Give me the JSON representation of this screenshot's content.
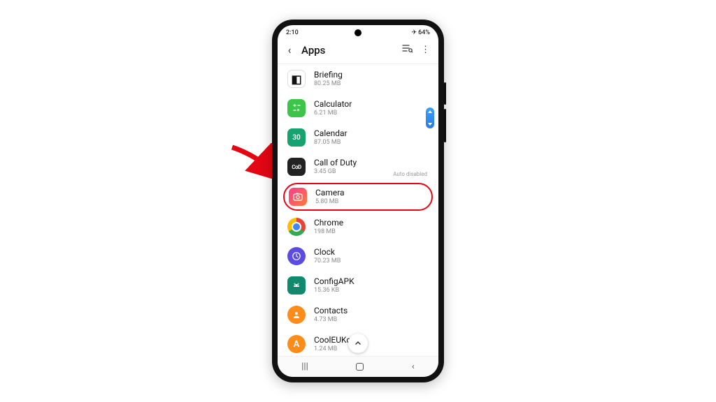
{
  "status": {
    "time": "2:10",
    "battery": "64%"
  },
  "header": {
    "title": "Apps"
  },
  "badge": {
    "auto_disabled": "Auto disabled"
  },
  "apps": [
    {
      "name": "Briefing",
      "sub": "80.25 MB",
      "icon": "briefing"
    },
    {
      "name": "Calculator",
      "sub": "6.21 MB",
      "icon": "calculator"
    },
    {
      "name": "Calendar",
      "sub": "87.05 MB",
      "icon": "calendar"
    },
    {
      "name": "Call of Duty",
      "sub": "3.45 GB",
      "icon": "cod",
      "auto_disabled": true
    },
    {
      "name": "Camera",
      "sub": "5.80 MB",
      "icon": "camera",
      "highlighted": true
    },
    {
      "name": "Chrome",
      "sub": "198 MB",
      "icon": "chrome"
    },
    {
      "name": "Clock",
      "sub": "70.23 MB",
      "icon": "clock"
    },
    {
      "name": "ConfigAPK",
      "sub": "15.36 KB",
      "icon": "config"
    },
    {
      "name": "Contacts",
      "sub": "4.73 MB",
      "icon": "contacts"
    },
    {
      "name": "CoolEUKor",
      "sub": "1.24 MB",
      "icon": "cooleukor"
    }
  ],
  "annotation": {
    "arrow_color": "#e30613"
  }
}
